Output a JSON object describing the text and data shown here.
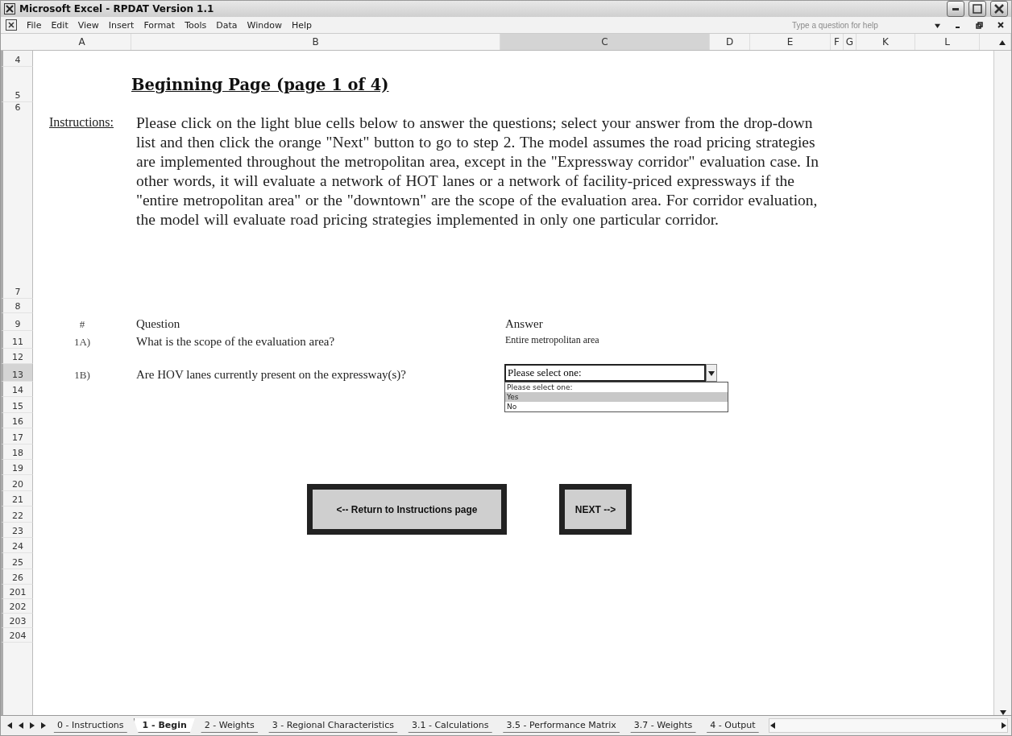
{
  "window": {
    "title": "Microsoft Excel - RPDAT Version 1.1"
  },
  "menu": [
    "File",
    "Edit",
    "View",
    "Insert",
    "Format",
    "Tools",
    "Data",
    "Window",
    "Help"
  ],
  "help_box": {
    "placeholder": "Type a question for help"
  },
  "columns": [
    {
      "label": "A",
      "selected": false
    },
    {
      "label": "B",
      "selected": false
    },
    {
      "label": "C",
      "selected": true
    },
    {
      "label": "D",
      "selected": false
    },
    {
      "label": "E",
      "selected": false
    },
    {
      "label": "F",
      "selected": false
    },
    {
      "label": "G",
      "selected": false
    },
    {
      "label": "K",
      "selected": false
    },
    {
      "label": "L",
      "selected": false
    }
  ],
  "rows": [
    {
      "label": "4",
      "selected": false
    },
    {
      "label": "5",
      "selected": false
    },
    {
      "label": "6",
      "selected": false
    },
    {
      "label": "7",
      "selected": false
    },
    {
      "label": "8",
      "selected": false
    },
    {
      "label": "9",
      "selected": false
    },
    {
      "label": "11",
      "selected": false
    },
    {
      "label": "12",
      "selected": false
    },
    {
      "label": "13",
      "selected": true
    },
    {
      "label": "14",
      "selected": false
    },
    {
      "label": "15",
      "selected": false
    },
    {
      "label": "16",
      "selected": false
    },
    {
      "label": "17",
      "selected": false
    },
    {
      "label": "18",
      "selected": false
    },
    {
      "label": "19",
      "selected": false
    },
    {
      "label": "20",
      "selected": false
    },
    {
      "label": "21",
      "selected": false
    },
    {
      "label": "22",
      "selected": false
    },
    {
      "label": "23",
      "selected": false
    },
    {
      "label": "24",
      "selected": false
    },
    {
      "label": "25",
      "selected": false
    },
    {
      "label": "26",
      "selected": false
    },
    {
      "label": "201",
      "selected": false
    },
    {
      "label": "202",
      "selected": false
    },
    {
      "label": "203",
      "selected": false
    },
    {
      "label": "204",
      "selected": false
    }
  ],
  "page_title": "Beginning Page (page 1 of 4)",
  "instructions": {
    "label": "Instructions:",
    "text": "Please click on the light blue cells below to answer the questions; select your answer from the drop-down list and then click the orange \"Next\" button to go to step 2.  The model assumes the road pricing strategies are implemented throughout the metropolitan area, except in the \"Expressway corridor\" evaluation case.  In other words, it will evaluate a network of HOT lanes or a network of facility-priced expressways if the \"entire metropolitan area\" or the \"downtown\" are the scope of the evaluation area.  For corridor evaluation, the model will evaluate road pricing strategies implemented in only one particular corridor."
  },
  "question_header": {
    "number": "#",
    "question": "Question",
    "answer": "Answer"
  },
  "questions": [
    {
      "number": "1A)",
      "text": "What is the scope of the evaluation area?",
      "kind": "text",
      "answer": "Entire metropolitan area"
    },
    {
      "number": "1B)",
      "text": "Are HOV lanes currently present on the expressway(s)?",
      "kind": "dropdown",
      "answer": "Please select one:",
      "options": [
        {
          "label": "Please select one:",
          "selected": false
        },
        {
          "label": "Yes",
          "selected": true
        },
        {
          "label": "No",
          "selected": false
        }
      ]
    }
  ],
  "buttons": [
    "<-- Return to Instructions page",
    "NEXT -->"
  ],
  "sheet_tabs": [
    {
      "label": "0 - Instructions",
      "selected": false
    },
    {
      "label": "1 - Begin",
      "selected": true
    },
    {
      "label": "2 - Weights",
      "selected": false
    },
    {
      "label": "3 - Regional Characteristics",
      "selected": false
    },
    {
      "label": "3.1 - Calculations",
      "selected": false
    },
    {
      "label": "3.5 - Performance Matrix",
      "selected": false
    },
    {
      "label": "3.7 - Weights",
      "selected": false
    },
    {
      "label": "4 - Output",
      "selected": false
    }
  ]
}
